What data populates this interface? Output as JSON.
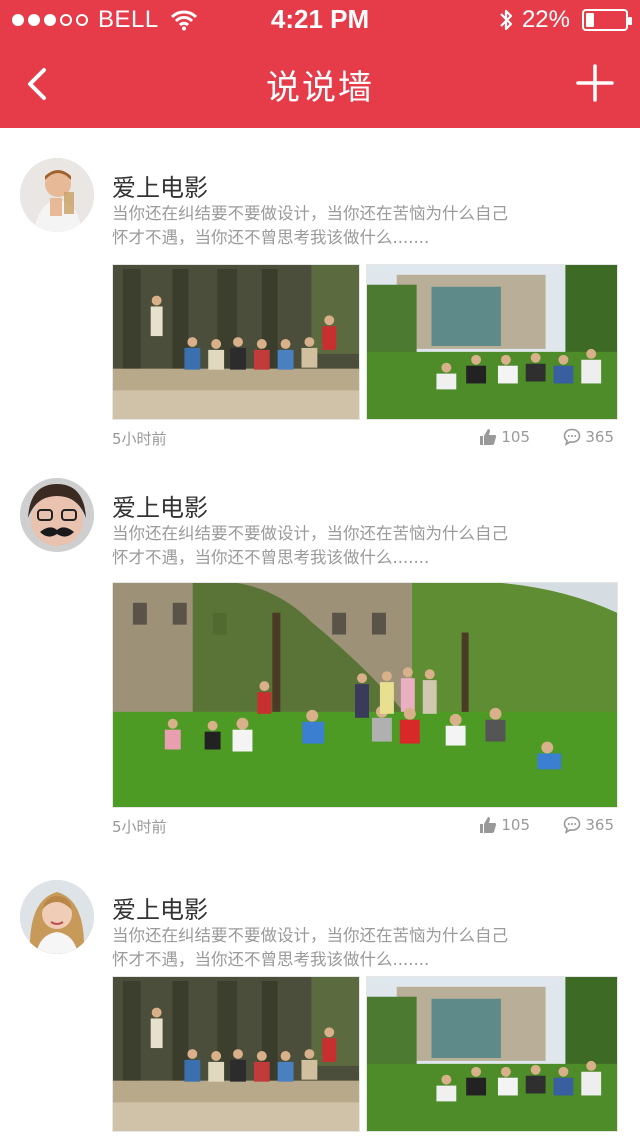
{
  "status_bar": {
    "carrier": "BELL",
    "time": "4:21 PM",
    "battery_text": "22%",
    "battery_level": 0.22
  },
  "nav": {
    "title": "说说墙",
    "back_icon": "chevron-left-icon",
    "add_icon": "plus-icon"
  },
  "colors": {
    "accent": "#e63c4a",
    "meta_text": "#999999"
  },
  "posts": [
    {
      "username": "爱上电影",
      "content_line1": "当你还在纠结要不要做设计，当你还在苦恼为什么自己",
      "content_line2": "怀才不遇，当你还不曾思考我该做什么.......",
      "time": "5小时前",
      "likes": "105",
      "comments": "365"
    },
    {
      "username": "爱上电影",
      "content_line1": "当你还在纠结要不要做设计，当你还在苦恼为什么自己",
      "content_line2": "怀才不遇，当你还不曾思考我该做什么.......",
      "time": "5小时前",
      "likes": "105",
      "comments": "365"
    },
    {
      "username": "爱上电影",
      "content_line1": "当你还在纠结要不要做设计，当你还在苦恼为什么自己",
      "content_line2": "怀才不遇，当你还不曾思考我该做什么......."
    }
  ]
}
